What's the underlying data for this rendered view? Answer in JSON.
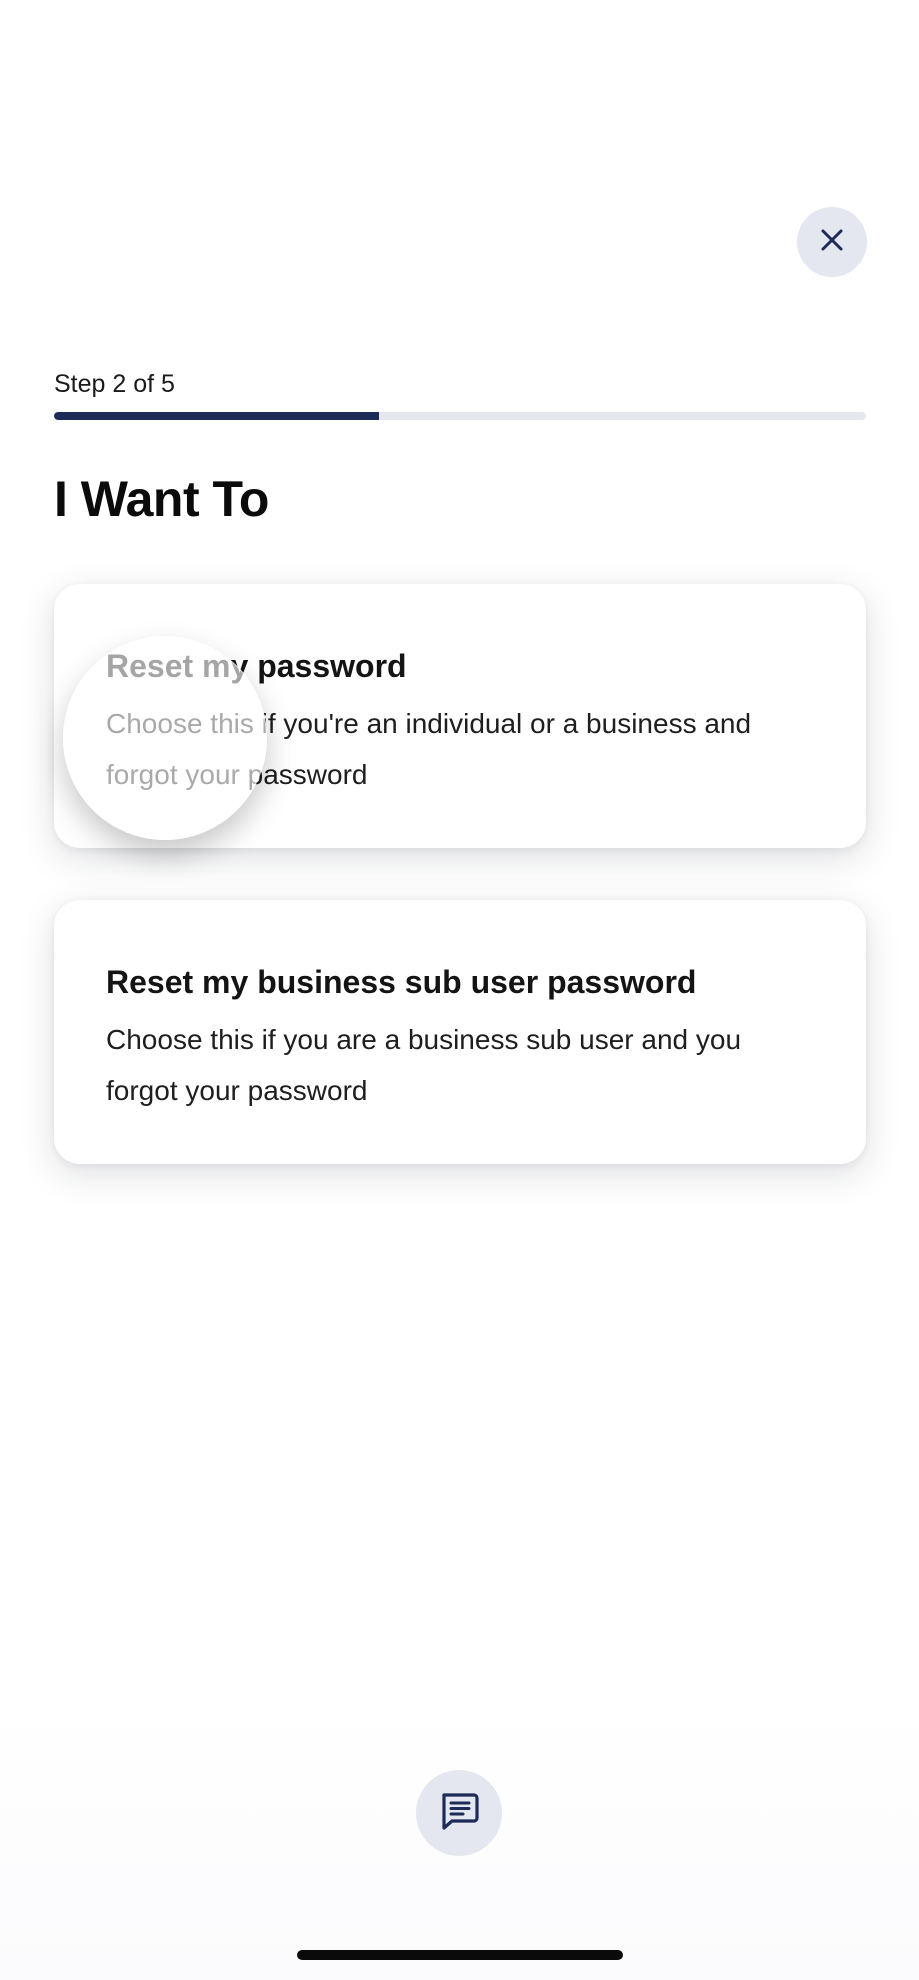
{
  "header": {
    "close_icon": "close-icon"
  },
  "progress": {
    "label": "Step 2 of 5",
    "current_step": 2,
    "total_steps": 5,
    "fill_fraction": 0.4,
    "fill_color": "#1d2b59",
    "track_color": "#e6e8ef"
  },
  "page": {
    "title": "I Want To"
  },
  "options": [
    {
      "title": "Reset my password",
      "description": "Choose this if you're an individual or a business and forgot your password"
    },
    {
      "title": "Reset my business sub user password",
      "description": "Choose this if you are a business sub user and you forgot your password"
    }
  ],
  "footer": {
    "chat_icon": "chat-icon"
  },
  "colors": {
    "accent": "#1d2b59",
    "icon_bg": "#e4e7ef"
  }
}
